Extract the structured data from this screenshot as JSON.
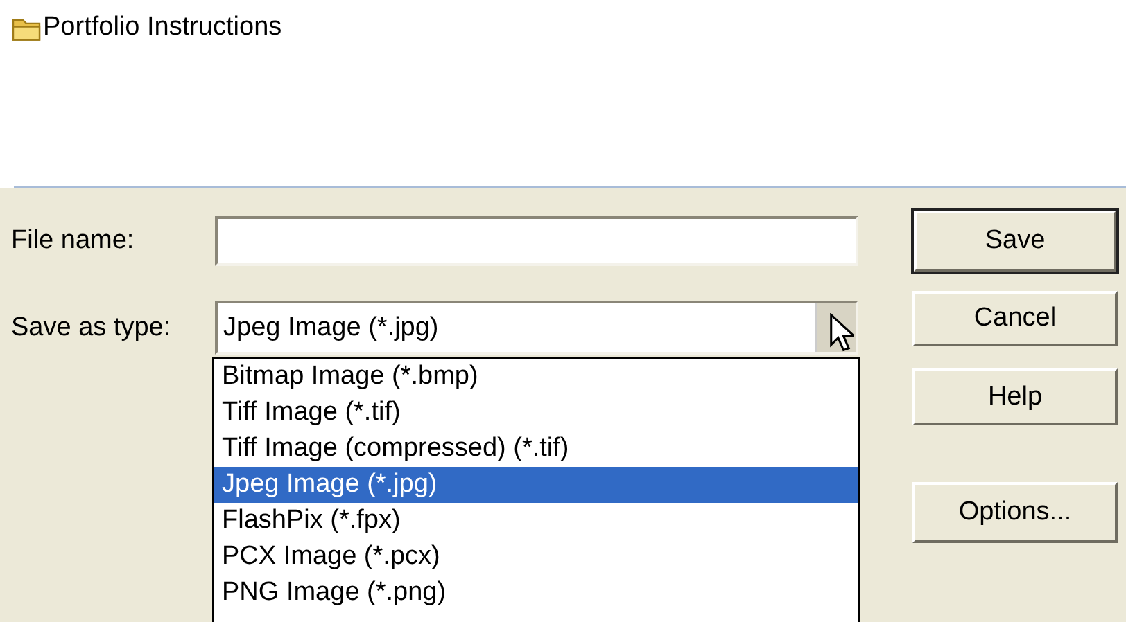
{
  "header": {
    "title": "Portfolio Instructions"
  },
  "file_name": {
    "label": "File name:"
  },
  "save_as_type": {
    "label": "Save as type:",
    "value": "Jpeg Image (*.jpg)",
    "expanded": true,
    "options": [
      {
        "label": "Bitmap Image (*.bmp)",
        "selected": false
      },
      {
        "label": "Tiff Image (*.tif)",
        "selected": false
      },
      {
        "label": "Tiff Image (compressed) (*.tif)",
        "selected": false
      },
      {
        "label": "Jpeg Image (*.jpg)",
        "selected": true
      },
      {
        "label": "FlashPix (*.fpx)",
        "selected": false
      },
      {
        "label": "PCX Image (*.pcx)",
        "selected": false
      },
      {
        "label": "PNG Image (*.png)",
        "selected": false
      }
    ]
  },
  "buttons": [
    {
      "label": "Save",
      "default": true
    },
    {
      "label": "Cancel",
      "default": false
    },
    {
      "label": "Help",
      "default": false
    },
    {
      "label": "Options...",
      "default": false
    }
  ]
}
